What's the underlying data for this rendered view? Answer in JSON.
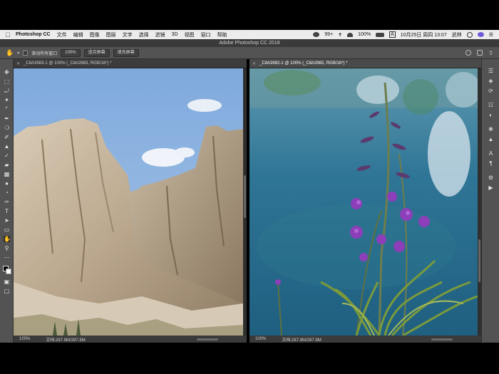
{
  "menubar": {
    "app_name": "Photoshop CC",
    "items": [
      "文件",
      "编辑",
      "图像",
      "图层",
      "文字",
      "选择",
      "滤镜",
      "3D",
      "视图",
      "窗口",
      "帮助"
    ],
    "wechat_badge": "99+",
    "battery": "100%",
    "input_method": "A",
    "date_time": "10月25日 周四  13:07",
    "user": "武林"
  },
  "window": {
    "title": "Adobe Photoshop CC 2018"
  },
  "options": {
    "scroll_all_label": "滚动所有窗口",
    "zoom_value": "100%",
    "fit_screen_label": "适合屏幕",
    "fill_screen_label": "填充屏幕"
  },
  "documents": [
    {
      "tab_title": "_C8A3983-1 @ 100% (_C8A3983, RGB/16*) *",
      "zoom": "100%",
      "doc_size": "文档:287.9M/287.9M"
    },
    {
      "tab_title": "_C8A3982-1 @ 100% (_C8A3982, RGB/16*) *",
      "zoom": "100%",
      "doc_size": "文档:287.9M/287.9M"
    }
  ],
  "tools": [
    "move-tool",
    "marquee-tool",
    "lasso-tool",
    "quick-select-tool",
    "crop-tool",
    "eyedropper-tool",
    "healing-brush-tool",
    "brush-tool",
    "clone-stamp-tool",
    "history-brush-tool",
    "eraser-tool",
    "gradient-tool",
    "blur-tool",
    "dodge-tool",
    "pen-tool",
    "type-tool",
    "path-select-tool",
    "rectangle-tool",
    "hand-tool",
    "zoom-tool",
    "edit-toolbar",
    "color-swatches",
    "quick-mask",
    "screen-mode"
  ],
  "colors": {
    "accent": "#535353",
    "doc_bg": "#282828",
    "menubar_bg": "#ececec"
  }
}
